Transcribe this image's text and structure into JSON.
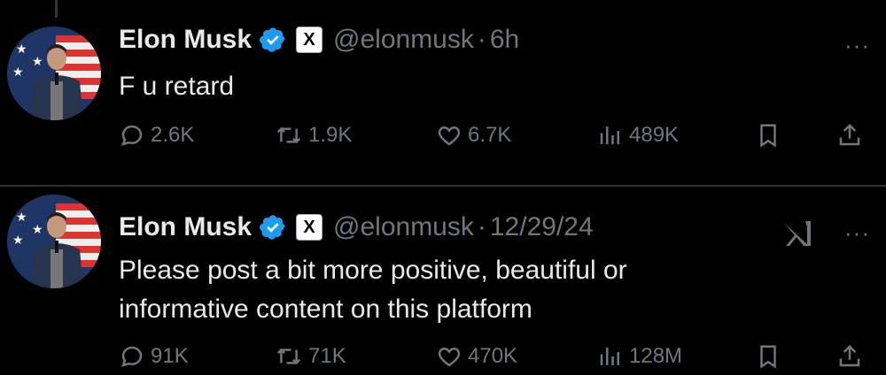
{
  "tweets": [
    {
      "name": "Elon Musk",
      "handle": "@elonmusk",
      "separator": "·",
      "time": "6h",
      "affiliate": "X",
      "more": "···",
      "text": "F u retard",
      "replies": "2.6K",
      "retweets": "1.9K",
      "likes": "6.7K",
      "views": "489K"
    },
    {
      "name": "Elon Musk",
      "handle": "@elonmusk",
      "separator": "·",
      "time": "12/29/24",
      "affiliate": "X",
      "more": "···",
      "text": "Please post a bit more positive, beautiful or informative content on this platform",
      "replies": "91K",
      "retweets": "71K",
      "likes": "470K",
      "views": "128M"
    }
  ],
  "colors": {
    "background": "#000000",
    "text": "#e7e9ea",
    "muted": "#71767b",
    "verified": "#1d9bf0",
    "divider": "#2f3336"
  },
  "icons": [
    "verified-badge-icon",
    "x-logo-icon",
    "more-icon",
    "reply-icon",
    "retweet-icon",
    "like-icon",
    "views-icon",
    "bookmark-icon",
    "share-icon",
    "xai-logo-icon"
  ]
}
